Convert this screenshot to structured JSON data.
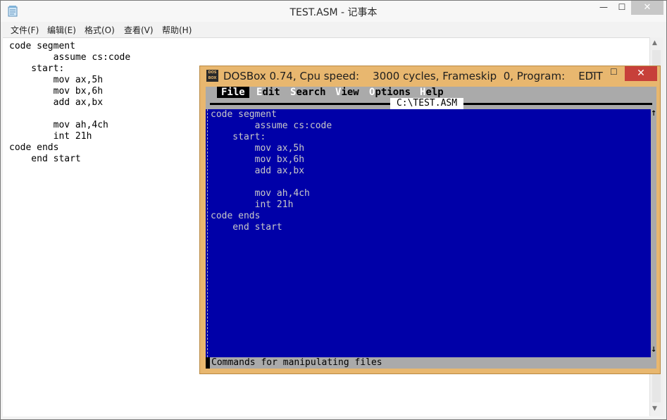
{
  "notepad": {
    "title": "TEST.ASM - 记事本",
    "menu": [
      "文件(F)",
      "编辑(E)",
      "格式(O)",
      "查看(V)",
      "帮助(H)"
    ],
    "content": "code segment\n        assume cs:code\n    start:\n        mov ax,5h\n        mov bx,6h\n        add ax,bx\n\n        mov ah,4ch\n        int 21h\ncode ends\n    end start",
    "window_controls": {
      "minimize": "—",
      "maximize": "☐",
      "close": "✕"
    }
  },
  "dosbox": {
    "title": "DOSBox 0.74, Cpu speed:    3000 cycles, Frameskip  0, Program:    EDIT",
    "window_controls": {
      "minimize": "—",
      "maximize": "☐",
      "close": "✕"
    },
    "menu": {
      "file": "File",
      "edit_hotkey": "E",
      "edit_rest": "dit",
      "search_hotkey": "S",
      "search_rest": "earch",
      "view_hotkey": "V",
      "view_rest": "iew",
      "options_hotkey": "O",
      "options_rest": "ptions",
      "help_hotkey": "H",
      "help_rest": "elp"
    },
    "filename": "C:\\TEST.ASM",
    "code": "code segment\n        assume cs:code\n    start:\n        mov ax,5h\n        mov bx,6h\n        add ax,bx\n\n        mov ah,4ch\n        int 21h\ncode ends\n    end start",
    "status": "Commands for manipulating files",
    "scroll_up": "↑",
    "scroll_down": "↓"
  }
}
